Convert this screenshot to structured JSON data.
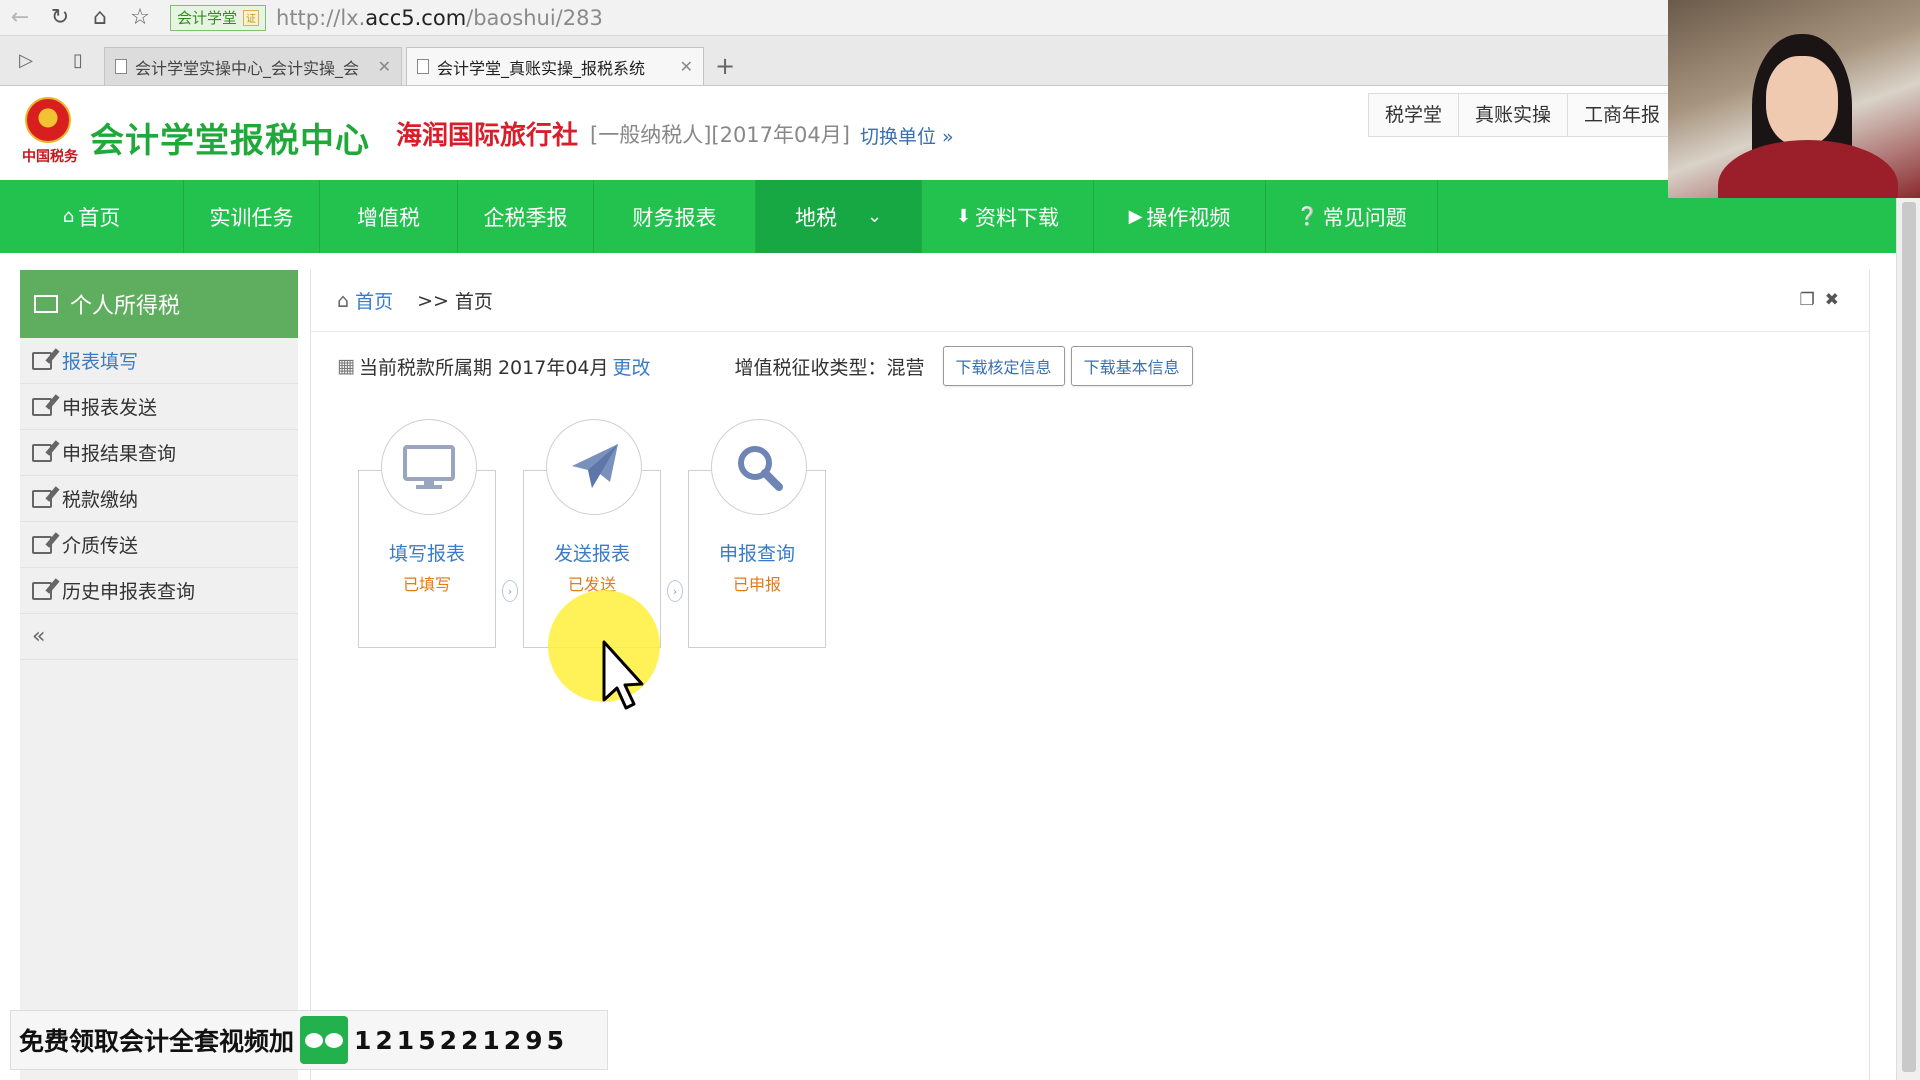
{
  "browser": {
    "site_badge": "会计学堂",
    "url_prefix": "http://lx.",
    "url_host": "acc5.com",
    "url_path": "/baoshui/283",
    "tabs": [
      {
        "title": "会计学堂实操中心_会计实操_会"
      },
      {
        "title": "会计学堂_真账实操_报税系统"
      }
    ],
    "new_tab": "+"
  },
  "header": {
    "emblem_script": "中国税务",
    "brand": "会计学堂报税中心",
    "company": "海润国际旅行社",
    "company_meta": "[一般纳税人][2017年04月]",
    "switch_unit": "切换单位 »",
    "top_links": [
      "税学堂",
      "真账实操",
      "工商年报"
    ]
  },
  "nav": {
    "items": [
      {
        "label": "首页",
        "icon": "home-icon"
      },
      {
        "label": "实训任务"
      },
      {
        "label": "增值税"
      },
      {
        "label": "企税季报"
      },
      {
        "label": "财务报表"
      },
      {
        "label": "地税",
        "dropdown": true
      },
      {
        "label": "资料下载",
        "icon": "download-icon"
      },
      {
        "label": "操作视频",
        "icon": "play-icon"
      },
      {
        "label": "常见问题",
        "icon": "question-icon"
      }
    ]
  },
  "sidebar": {
    "title": "个人所得税",
    "items": [
      {
        "label": "报表填写"
      },
      {
        "label": "申报表发送"
      },
      {
        "label": "申报结果查询"
      },
      {
        "label": "税款缴纳"
      },
      {
        "label": "介质传送"
      },
      {
        "label": "历史申报表查询"
      }
    ],
    "collapse": "«"
  },
  "content": {
    "breadcrumb_home": "首页",
    "breadcrumb_sep": ">>",
    "breadcrumb_current": "首页",
    "period_label": "当前税款所属期",
    "period_value": "2017年04月",
    "period_change": "更改",
    "tax_type_label": "增值税征收类型：",
    "tax_type_value": "混营",
    "btn_download_approved": "下载核定信息",
    "btn_download_basic": "下载基本信息",
    "steps": [
      {
        "label": "填写报表",
        "status": "已填写",
        "icon": "monitor-icon"
      },
      {
        "label": "发送报表",
        "status": "已发送",
        "icon": "paper-plane-icon"
      },
      {
        "label": "申报查询",
        "status": "已申报",
        "icon": "search-icon"
      }
    ]
  },
  "promo": {
    "text": "免费领取会计全套视频加",
    "number": "1215221295"
  },
  "colors": {
    "nav_green": "#23c24f",
    "brand_green": "#20a83a",
    "company_red": "#d81e2a",
    "link_blue": "#3a7bc8",
    "status_orange": "#e07b1a"
  }
}
